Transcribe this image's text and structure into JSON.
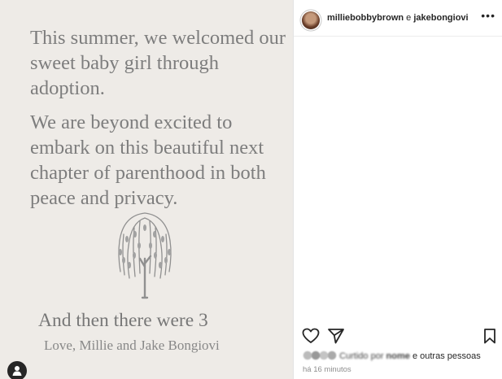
{
  "post_image": {
    "paragraph1": "This summer, we welcomed our sweet baby girl through adoption.",
    "paragraph2": "We are beyond excited to embark on this beautiful next chapter of parenthood in both peace and privacy.",
    "closing": "And then there were 3",
    "signature": "Love, Millie and Jake Bongiovi",
    "icons": [
      "willow-tree-icon",
      "user-tag-icon"
    ]
  },
  "header": {
    "user1": "milliebobbybrown",
    "connector": " e ",
    "user2": "jakebongiovi",
    "more": "•••"
  },
  "actions": {
    "icons": [
      "heart-icon",
      "share-icon",
      "bookmark-icon"
    ]
  },
  "likes": {
    "prefix": "Curtido por",
    "blurred_name": "nome",
    "suffix": " e outras pessoas"
  },
  "timestamp": "há 16 minutos"
}
